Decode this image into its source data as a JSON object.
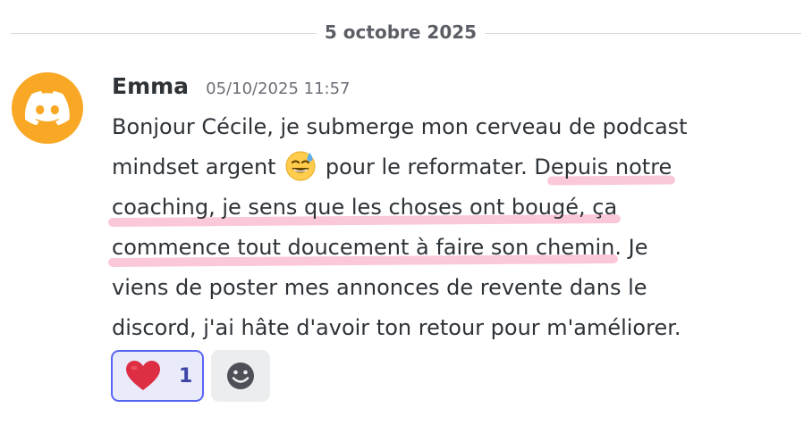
{
  "divider": {
    "date": "5 octobre 2025"
  },
  "message": {
    "avatar_icon": "discord-logo-icon",
    "avatar_color": "#f9a825",
    "author": "Emma",
    "timestamp": "05/10/2025 11:57",
    "lines": [
      [
        "Bonjour Cécile, je submerge mon cerveau de podcast"
      ],
      [
        "mindset argent ",
        "grinning-sweat-emoji",
        " pour le reformater. D",
        "epuis notre"
      ],
      [
        "coaching, je sens que les choses ont bougé, ça"
      ],
      [
        "commence tout doucement à faire son chemin",
        ". Je"
      ],
      [
        "viens de poster mes annonces de revente dans le"
      ],
      [
        "discord, j'ai hâte d'avoir ton retour pour m'améliorer."
      ]
    ],
    "highlight_color": "#fbc8d9"
  },
  "reactions": [
    {
      "icon": "red-heart-icon",
      "count": "1",
      "active": true
    }
  ],
  "add_reaction": {
    "icon": "smiley-add-reaction-icon"
  }
}
